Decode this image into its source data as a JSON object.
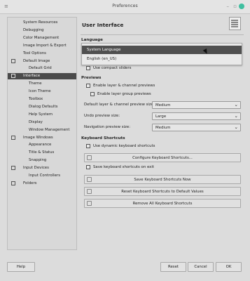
{
  "window": {
    "title": "Preferences",
    "menu_icon": "≡",
    "minimize": "–",
    "maximize": "▫"
  },
  "tree": [
    {
      "label": "System Resources",
      "indent": 1,
      "exp": false,
      "sel": false
    },
    {
      "label": "Debugging",
      "indent": 1,
      "exp": false,
      "sel": false
    },
    {
      "label": "Color Management",
      "indent": 1,
      "exp": false,
      "sel": false
    },
    {
      "label": "Image Import & Export",
      "indent": 1,
      "exp": false,
      "sel": false
    },
    {
      "label": "Tool Options",
      "indent": 1,
      "exp": false,
      "sel": false
    },
    {
      "label": "Default Image",
      "indent": 1,
      "exp": true,
      "sel": false
    },
    {
      "label": "Default Grid",
      "indent": 2,
      "exp": false,
      "sel": false
    },
    {
      "label": "Interface",
      "indent": 1,
      "exp": true,
      "sel": true
    },
    {
      "label": "Theme",
      "indent": 2,
      "exp": false,
      "sel": false
    },
    {
      "label": "Icon Theme",
      "indent": 2,
      "exp": false,
      "sel": false
    },
    {
      "label": "Toolbox",
      "indent": 2,
      "exp": false,
      "sel": false
    },
    {
      "label": "Dialog Defaults",
      "indent": 2,
      "exp": false,
      "sel": false
    },
    {
      "label": "Help System",
      "indent": 2,
      "exp": false,
      "sel": false
    },
    {
      "label": "Display",
      "indent": 2,
      "exp": false,
      "sel": false
    },
    {
      "label": "Window Management",
      "indent": 2,
      "exp": false,
      "sel": false
    },
    {
      "label": "Image Windows",
      "indent": 1,
      "exp": true,
      "sel": false
    },
    {
      "label": "Appearance",
      "indent": 2,
      "exp": false,
      "sel": false
    },
    {
      "label": "Title & Status",
      "indent": 2,
      "exp": false,
      "sel": false
    },
    {
      "label": "Snapping",
      "indent": 2,
      "exp": false,
      "sel": false
    },
    {
      "label": "Input Devices",
      "indent": 1,
      "exp": true,
      "sel": false
    },
    {
      "label": "Input Controllers",
      "indent": 2,
      "exp": false,
      "sel": false
    },
    {
      "label": "Folders",
      "indent": 1,
      "exp": true,
      "sel": false
    }
  ],
  "header": {
    "title": "User Interface"
  },
  "language": {
    "section": "Language",
    "occluded_label": "St",
    "compact_sliders": "Use compact sliders",
    "options": [
      "System Language",
      "English (en_US)"
    ]
  },
  "previews": {
    "section": "Previews",
    "enable_layer_channel": "Enable layer & channel previews",
    "enable_layer_group": "Enable layer group previews",
    "default_size_label": "Default layer & channel preview size:",
    "default_size_value": "Medium",
    "undo_size_label": "Undo preview size:",
    "undo_size_value": "Large",
    "nav_size_label": "Navigation preview size:",
    "nav_size_value": "Medium"
  },
  "shortcuts": {
    "section": "Keyboard Shortcuts",
    "use_dynamic": "Use dynamic keyboard shortcuts",
    "configure": "Configure Keyboard Shortcuts...",
    "save_on_exit": "Save keyboard shortcuts on exit",
    "save_now": "Save Keyboard Shortcuts Now",
    "reset": "Reset Keyboard Shortcuts to Default Values",
    "remove_all": "Remove All Keyboard Shortcuts"
  },
  "buttons": {
    "help": "Help",
    "reset": "Reset",
    "cancel": "Cancel",
    "ok": "OK"
  }
}
